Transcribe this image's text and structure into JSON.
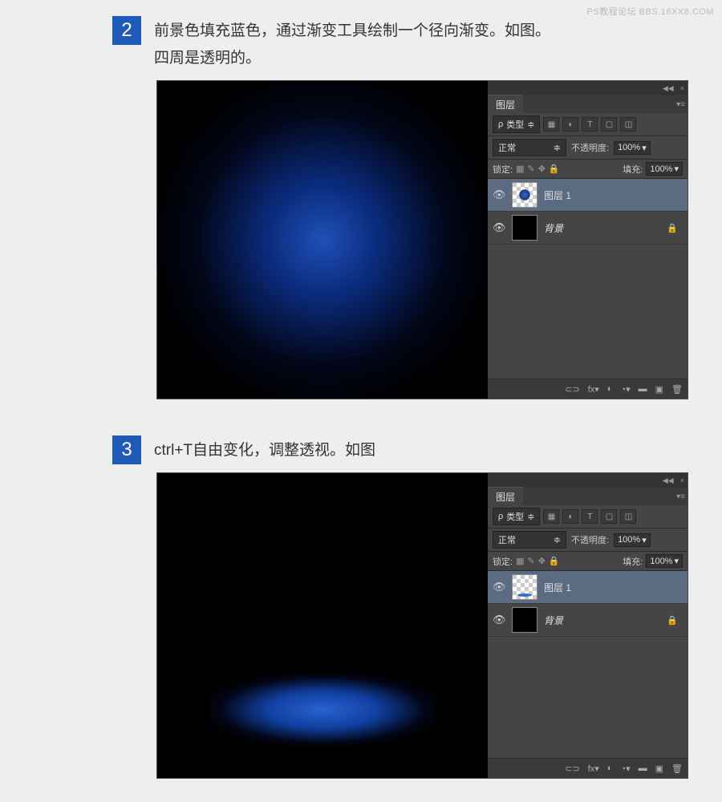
{
  "watermark": "PS教程论坛 BBS.16XX8.COM",
  "steps": [
    {
      "num": "2",
      "text_line1": "前景色填充蓝色，通过渐变工具绘制一个径向渐变。如图。",
      "text_line2": "四周是透明的。"
    },
    {
      "num": "3",
      "text_line1": "ctrl+T自由变化，调整透视。如图",
      "text_line2": ""
    }
  ],
  "panel": {
    "tab": "图层",
    "kind_label": "类型",
    "search": "ρ",
    "blend_mode": "正常",
    "opacity_label": "不透明度:",
    "opacity_value": "100%",
    "lock_label": "锁定:",
    "fill_label": "填充:",
    "fill_value": "100%",
    "layer1": "图层 1",
    "bg": "背景",
    "collapse": "◀◀",
    "close": "×",
    "menu": "▾≡",
    "filter_icons": [
      "▦",
      "◐",
      "T",
      "▢",
      "◫"
    ],
    "lock_icons": [
      "▦",
      "✎",
      "✥",
      "🔒"
    ],
    "footer_icons": [
      "⊂⊃",
      "fx▾",
      "◐",
      "◔▾",
      "▬",
      "▣",
      "🗑"
    ]
  }
}
